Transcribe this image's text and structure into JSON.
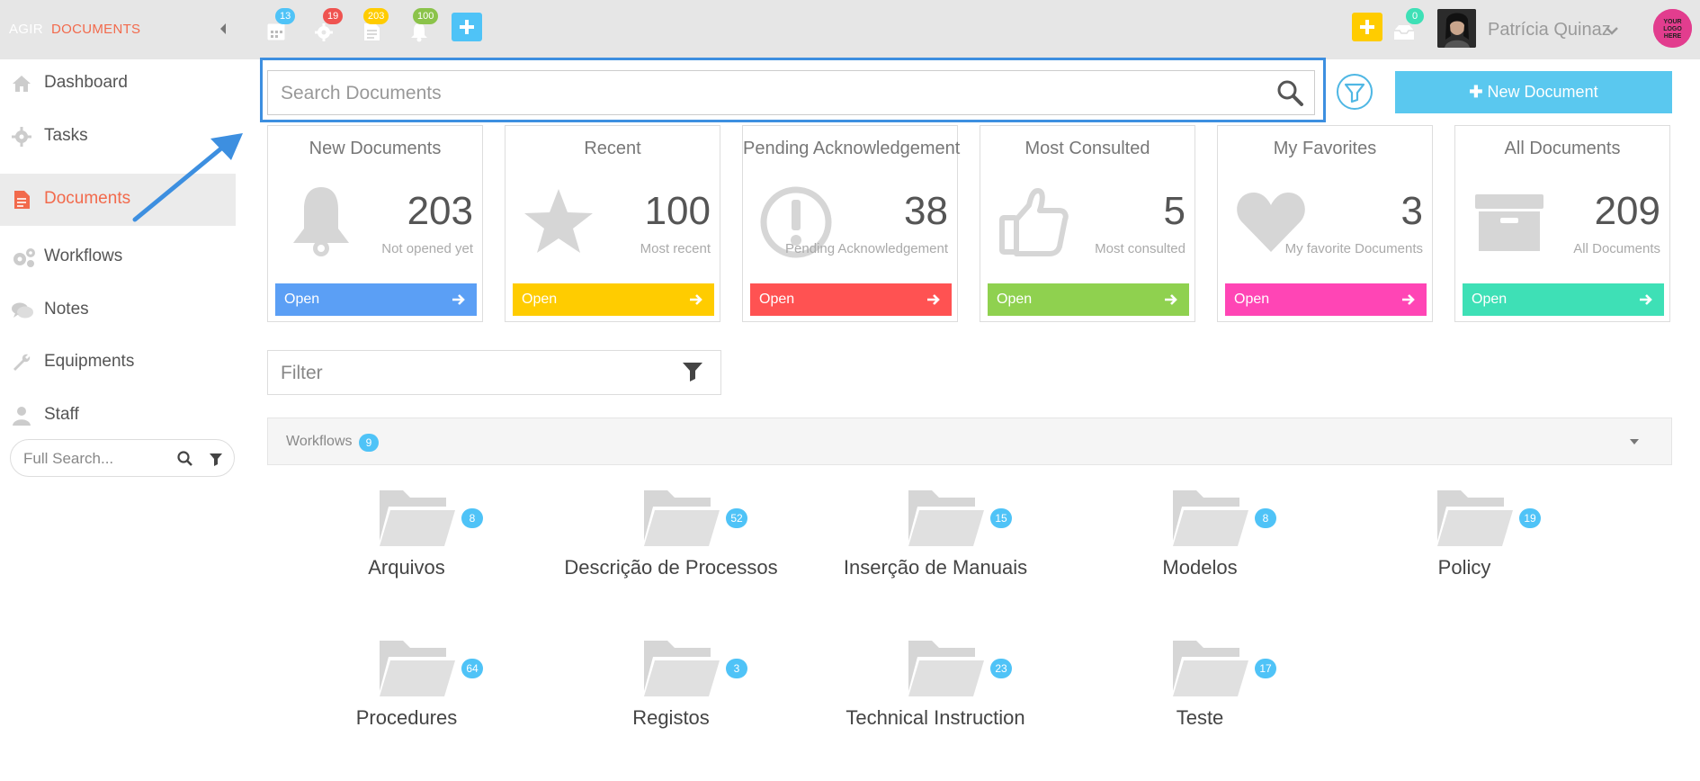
{
  "topbar": {
    "app": "AGIR",
    "section": "DOCUMENTS",
    "icons": [
      {
        "name": "calendar-icon",
        "badge": "13",
        "color": "#4fc3f7"
      },
      {
        "name": "gear-icon",
        "badge": "19",
        "color": "#ef5350"
      },
      {
        "name": "document-icon",
        "badge": "203",
        "color": "#ffcc00"
      },
      {
        "name": "bell-icon",
        "badge": "100",
        "color": "#8bc34a"
      }
    ],
    "inbox_badge": "0",
    "user_name": "Patrícia Quinaz",
    "logo_text": [
      "YOUR",
      "LOGO",
      "HERE"
    ]
  },
  "sidebar": {
    "items": [
      {
        "label": "Dashboard",
        "icon": "home-icon"
      },
      {
        "label": "Tasks",
        "icon": "gear-icon"
      },
      {
        "label": "Documents",
        "icon": "document-icon",
        "active": true
      },
      {
        "label": "Workflows",
        "icon": "gears-icon"
      },
      {
        "label": "Notes",
        "icon": "comments-icon"
      },
      {
        "label": "Equipments",
        "icon": "wrench-icon"
      },
      {
        "label": "Staff",
        "icon": "user-icon"
      }
    ],
    "full_search_placeholder": "Full Search..."
  },
  "search": {
    "placeholder": "Search Documents",
    "new_document": "New Document"
  },
  "cards": [
    {
      "title": "New Documents",
      "count": "203",
      "subtitle": "Not opened yet",
      "open": "Open",
      "color": "#5b9ff5",
      "icon": "bell-icon"
    },
    {
      "title": "Recent",
      "count": "100",
      "subtitle": "Most recent",
      "open": "Open",
      "color": "#ffcc00",
      "icon": "star-icon"
    },
    {
      "title": "Pending Acknowledgement",
      "count": "38",
      "subtitle": "Pending Acknowledgement",
      "open": "Open",
      "color": "#ff5252",
      "icon": "exclamation-icon"
    },
    {
      "title": "Most Consulted",
      "count": "5",
      "subtitle": "Most consulted",
      "open": "Open",
      "color": "#8fd14f",
      "icon": "thumbs-up-icon"
    },
    {
      "title": "My Favorites",
      "count": "3",
      "subtitle": "My favorite Documents",
      "open": "Open",
      "color": "#ff45b5",
      "icon": "heart-icon"
    },
    {
      "title": "All Documents",
      "count": "209",
      "subtitle": "All Documents",
      "open": "Open",
      "color": "#3ee0b6",
      "icon": "archive-icon"
    }
  ],
  "filter": {
    "placeholder": "Filter"
  },
  "workflows": {
    "title": "Workflows",
    "count": "9",
    "folders": [
      {
        "label": "Arquivos",
        "count": "8"
      },
      {
        "label": "Descrição de Processos",
        "count": "52"
      },
      {
        "label": "Inserção de Manuais",
        "count": "15"
      },
      {
        "label": "Modelos",
        "count": "8"
      },
      {
        "label": "Policy",
        "count": "19"
      },
      {
        "label": "Procedures",
        "count": "64"
      },
      {
        "label": "Registos",
        "count": "3"
      },
      {
        "label": "Technical Instruction",
        "count": "23"
      },
      {
        "label": "Teste",
        "count": "17"
      }
    ]
  }
}
